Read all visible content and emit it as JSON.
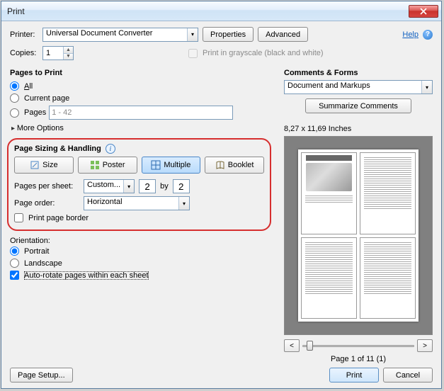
{
  "window": {
    "title": "Print"
  },
  "help": {
    "label": "Help"
  },
  "top": {
    "printer_label": "Printer:",
    "printer_selected": "Universal Document Converter",
    "properties": "Properties",
    "advanced": "Advanced",
    "copies_label": "Copies:",
    "copies_value": "1",
    "grayscale": "Print in grayscale (black and white)"
  },
  "pages": {
    "title": "Pages to Print",
    "all": "All",
    "current": "Current page",
    "pages": "Pages",
    "pages_value": "1 - 42",
    "more": "More Options"
  },
  "sizing": {
    "title": "Page Sizing & Handling",
    "size": "Size",
    "poster": "Poster",
    "multiple": "Multiple",
    "booklet": "Booklet",
    "pps_label": "Pages per sheet:",
    "pps_mode": "Custom...",
    "pps_a": "2",
    "pps_by": "by",
    "pps_b": "2",
    "order_label": "Page order:",
    "order_value": "Horizontal",
    "border": "Print page border"
  },
  "orientation": {
    "title": "Orientation:",
    "portrait": "Portrait",
    "landscape": "Landscape",
    "autorotate": "Auto-rotate pages within each sheet"
  },
  "comments": {
    "title": "Comments & Forms",
    "selected": "Document and Markups",
    "summarize": "Summarize Comments"
  },
  "preview": {
    "dims": "8,27 x 11,69 Inches",
    "page_status": "Page 1 of 11 (1)",
    "prev": "<",
    "next": ">"
  },
  "footer": {
    "page_setup": "Page Setup...",
    "print": "Print",
    "cancel": "Cancel"
  }
}
